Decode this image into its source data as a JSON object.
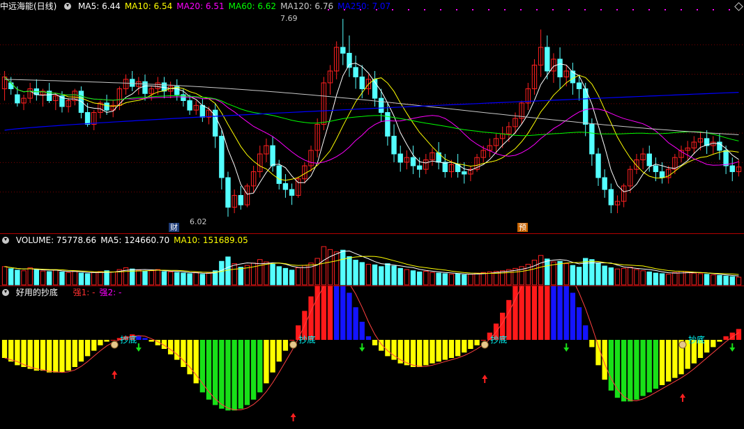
{
  "main": {
    "title": "中远海能(日线)",
    "ma_labels": [
      {
        "text": "MA5: 6.44",
        "color": "#ffffff"
      },
      {
        "text": "MA10: 6.54",
        "color": "#ffff00"
      },
      {
        "text": "MA20: 6.51",
        "color": "#ff00ff"
      },
      {
        "text": "MA60: 6.62",
        "color": "#00ff00"
      },
      {
        "text": "MA120: 6.76",
        "color": "#c8c8c8"
      },
      {
        "text": "MA250: 7.07",
        "color": "#0000ff"
      }
    ],
    "high_label": "7.69",
    "low_label": "6.02",
    "event_cai": "财",
    "event_yu": "预"
  },
  "volume": {
    "labels": [
      {
        "text": "VOLUME: 75778.66",
        "color": "#ffffff"
      },
      {
        "text": "MA5: 124660.70",
        "color": "#ffffff"
      },
      {
        "text": "MA10: 151689.05",
        "color": "#ffff00"
      }
    ]
  },
  "indicator": {
    "title": "好用的抄底",
    "labels": [
      {
        "text": "强1: -",
        "color": "#ff3030"
      },
      {
        "text": "强2: -",
        "color": "#ff00ff"
      }
    ],
    "signal_text": "抄底"
  },
  "colors": {
    "up": "#ff2020",
    "down": "#54ffff",
    "grid": "#800000",
    "ma5": "#ffffff",
    "ma10": "#ffff00",
    "ma20": "#ff00ff",
    "ma60": "#00ff00",
    "ma120": "#c8c8c8",
    "ma250": "#0000ff"
  },
  "chart_data": {
    "type": "candlestick",
    "price_high": 7.69,
    "price_low": 6.02,
    "ma_last": {
      "ma5": 6.44,
      "ma10": 6.54,
      "ma20": 6.51,
      "ma60": 6.62,
      "ma120": 6.76,
      "ma250": 7.07
    },
    "volume_last": 75778.66,
    "volume_ma5": 124660.7,
    "volume_ma10": 151689.05,
    "candles": [
      [
        7.1,
        7.25,
        7.2,
        7.0
      ],
      [
        7.15,
        7.2,
        7.1,
        7.05
      ],
      [
        7.05,
        7.12,
        6.98,
        6.95
      ],
      [
        6.98,
        7.05,
        7.02,
        6.92
      ],
      [
        7.02,
        7.15,
        7.1,
        6.98
      ],
      [
        7.1,
        7.18,
        7.05,
        7.0
      ],
      [
        7.05,
        7.1,
        7.08,
        6.95
      ],
      [
        7.08,
        7.15,
        7.0,
        6.98
      ],
      [
        7.0,
        7.06,
        7.04,
        6.92
      ],
      [
        7.04,
        7.08,
        6.95,
        6.9
      ],
      [
        6.95,
        7.02,
        7.0,
        6.9
      ],
      [
        7.0,
        7.1,
        7.08,
        6.96
      ],
      [
        7.08,
        7.12,
        6.9,
        6.85
      ],
      [
        6.9,
        6.98,
        6.8,
        6.78
      ],
      [
        6.8,
        6.92,
        6.9,
        6.75
      ],
      [
        6.9,
        7.0,
        6.98,
        6.85
      ],
      [
        6.98,
        7.05,
        6.92,
        6.88
      ],
      [
        6.92,
        7.0,
        6.96,
        6.86
      ],
      [
        6.96,
        7.12,
        7.1,
        6.92
      ],
      [
        7.1,
        7.22,
        7.18,
        7.05
      ],
      [
        7.18,
        7.25,
        7.12,
        7.08
      ],
      [
        7.12,
        7.2,
        7.16,
        7.05
      ],
      [
        7.16,
        7.22,
        7.06,
        7.0
      ],
      [
        7.06,
        7.12,
        7.1,
        7.0
      ],
      [
        7.1,
        7.2,
        7.15,
        7.05
      ],
      [
        7.15,
        7.2,
        7.08,
        7.02
      ],
      [
        7.08,
        7.16,
        7.12,
        7.02
      ],
      [
        7.12,
        7.18,
        7.05,
        7.0
      ],
      [
        7.05,
        7.1,
        7.0,
        6.95
      ],
      [
        7.0,
        7.05,
        6.92,
        6.88
      ],
      [
        6.92,
        7.0,
        6.96,
        6.88
      ],
      [
        6.96,
        7.02,
        6.86,
        6.82
      ],
      [
        6.86,
        6.95,
        6.92,
        6.8
      ],
      [
        6.92,
        6.98,
        6.7,
        6.6
      ],
      [
        6.7,
        6.75,
        6.35,
        6.25
      ],
      [
        6.35,
        6.4,
        6.1,
        6.02
      ],
      [
        6.1,
        6.25,
        6.2,
        6.05
      ],
      [
        6.2,
        6.28,
        6.12,
        6.08
      ],
      [
        6.12,
        6.3,
        6.28,
        6.1
      ],
      [
        6.28,
        6.45,
        6.4,
        6.22
      ],
      [
        6.4,
        6.62,
        6.55,
        6.35
      ],
      [
        6.55,
        6.68,
        6.62,
        6.48
      ],
      [
        6.62,
        6.7,
        6.45,
        6.4
      ],
      [
        6.45,
        6.5,
        6.3,
        6.25
      ],
      [
        6.3,
        6.38,
        6.25,
        6.18
      ],
      [
        6.25,
        6.3,
        6.2,
        6.12
      ],
      [
        6.2,
        6.36,
        6.34,
        6.18
      ],
      [
        6.34,
        6.48,
        6.45,
        6.3
      ],
      [
        6.45,
        6.62,
        6.58,
        6.4
      ],
      [
        6.58,
        6.85,
        6.8,
        6.52
      ],
      [
        6.8,
        7.2,
        7.15,
        6.75
      ],
      [
        7.15,
        7.3,
        7.25,
        7.05
      ],
      [
        7.25,
        7.5,
        7.45,
        7.18
      ],
      [
        7.45,
        7.69,
        7.4,
        7.3
      ],
      [
        7.4,
        7.55,
        7.28,
        7.2
      ],
      [
        7.28,
        7.38,
        7.2,
        7.1
      ],
      [
        7.2,
        7.3,
        7.1,
        7.02
      ],
      [
        7.1,
        7.22,
        7.18,
        7.05
      ],
      [
        7.18,
        7.25,
        7.02,
        6.95
      ],
      [
        7.02,
        7.1,
        6.9,
        6.82
      ],
      [
        6.9,
        6.98,
        6.7,
        6.62
      ],
      [
        6.7,
        6.8,
        6.55,
        6.48
      ],
      [
        6.55,
        6.62,
        6.48,
        6.4
      ],
      [
        6.48,
        6.58,
        6.52,
        6.42
      ],
      [
        6.52,
        6.62,
        6.45,
        6.38
      ],
      [
        6.45,
        6.52,
        6.42,
        6.35
      ],
      [
        6.42,
        6.55,
        6.5,
        6.38
      ],
      [
        6.5,
        6.6,
        6.56,
        6.45
      ],
      [
        6.56,
        6.65,
        6.48,
        6.42
      ],
      [
        6.48,
        6.55,
        6.4,
        6.35
      ],
      [
        6.4,
        6.5,
        6.46,
        6.35
      ],
      [
        6.46,
        6.55,
        6.4,
        6.35
      ],
      [
        6.4,
        6.48,
        6.38,
        6.3
      ],
      [
        6.38,
        6.45,
        6.42,
        6.32
      ],
      [
        6.42,
        6.55,
        6.52,
        6.4
      ],
      [
        6.52,
        6.62,
        6.58,
        6.48
      ],
      [
        6.58,
        6.68,
        6.62,
        6.52
      ],
      [
        6.62,
        6.72,
        6.68,
        6.55
      ],
      [
        6.68,
        6.78,
        6.72,
        6.6
      ],
      [
        6.72,
        6.82,
        6.78,
        6.65
      ],
      [
        6.78,
        6.9,
        6.85,
        6.72
      ],
      [
        6.85,
        7.0,
        6.98,
        6.8
      ],
      [
        6.98,
        7.15,
        7.1,
        6.92
      ],
      [
        7.1,
        7.35,
        7.3,
        7.05
      ],
      [
        7.3,
        7.6,
        7.45,
        7.2
      ],
      [
        7.45,
        7.55,
        7.25,
        7.18
      ],
      [
        7.25,
        7.4,
        7.35,
        7.15
      ],
      [
        7.35,
        7.45,
        7.2,
        7.1
      ],
      [
        7.2,
        7.3,
        7.25,
        7.12
      ],
      [
        7.25,
        7.32,
        7.15,
        7.05
      ],
      [
        7.15,
        7.22,
        7.1,
        7.0
      ],
      [
        7.1,
        7.15,
        6.8,
        6.7
      ],
      [
        6.8,
        6.85,
        6.55,
        6.45
      ],
      [
        6.55,
        6.6,
        6.35,
        6.28
      ],
      [
        6.35,
        6.42,
        6.25,
        6.18
      ],
      [
        6.25,
        6.3,
        6.12,
        6.05
      ],
      [
        6.12,
        6.2,
        6.15,
        6.05
      ],
      [
        6.15,
        6.3,
        6.28,
        6.1
      ],
      [
        6.28,
        6.45,
        6.42,
        6.22
      ],
      [
        6.42,
        6.55,
        6.5,
        6.38
      ],
      [
        6.5,
        6.6,
        6.55,
        6.42
      ],
      [
        6.55,
        6.62,
        6.45,
        6.4
      ],
      [
        6.45,
        6.52,
        6.4,
        6.32
      ],
      [
        6.4,
        6.48,
        6.35,
        6.3
      ],
      [
        6.35,
        6.45,
        6.42,
        6.3
      ],
      [
        6.42,
        6.55,
        6.52,
        6.38
      ],
      [
        6.52,
        6.62,
        6.58,
        6.48
      ],
      [
        6.58,
        6.66,
        6.6,
        6.5
      ],
      [
        6.6,
        6.7,
        6.65,
        6.55
      ],
      [
        6.65,
        6.74,
        6.68,
        6.58
      ],
      [
        6.68,
        6.75,
        6.62,
        6.55
      ],
      [
        6.62,
        6.7,
        6.65,
        6.55
      ],
      [
        6.65,
        6.72,
        6.58,
        6.5
      ],
      [
        6.58,
        6.62,
        6.45,
        6.38
      ],
      [
        6.45,
        6.52,
        6.4,
        6.32
      ],
      [
        6.4,
        6.5,
        6.44,
        6.36
      ]
    ],
    "volume": [
      62,
      55,
      50,
      48,
      58,
      52,
      47,
      45,
      50,
      44,
      42,
      46,
      40,
      38,
      42,
      45,
      48,
      44,
      52,
      58,
      54,
      50,
      46,
      48,
      52,
      45,
      44,
      42,
      40,
      38,
      42,
      36,
      40,
      48,
      80,
      95,
      72,
      60,
      66,
      74,
      86,
      78,
      70,
      62,
      56,
      50,
      58,
      66,
      74,
      90,
      130,
      120,
      112,
      118,
      96,
      84,
      76,
      70,
      68,
      62,
      72,
      64,
      56,
      52,
      48,
      44,
      46,
      42,
      40,
      38,
      36,
      38,
      34,
      36,
      40,
      42,
      44,
      46,
      48,
      52,
      56,
      62,
      70,
      84,
      100,
      88,
      78,
      80,
      72,
      66,
      60,
      90,
      86,
      74,
      64,
      58,
      54,
      56,
      60,
      52,
      48,
      44,
      40,
      38,
      36,
      42,
      46,
      44,
      40,
      38,
      36,
      34,
      32,
      30,
      28,
      26
    ],
    "indicator": [
      -10,
      -12,
      -14,
      -15,
      -16,
      -17,
      -17,
      -18,
      -18,
      -18,
      -17,
      -15,
      -12,
      -9,
      -6,
      -3,
      -1,
      0,
      1,
      2,
      3,
      2,
      1,
      -1,
      -3,
      -5,
      -8,
      -11,
      -15,
      -19,
      -24,
      -29,
      -33,
      -36,
      -38,
      -39,
      -39,
      -38,
      -36,
      -33,
      -29,
      -24,
      -18,
      -12,
      -6,
      0,
      8,
      16,
      24,
      30,
      34,
      36,
      35,
      32,
      26,
      18,
      10,
      2,
      -3,
      -6,
      -9,
      -11,
      -13,
      -14,
      -15,
      -15,
      -14,
      -13,
      -12,
      -11,
      -10,
      -9,
      -7,
      -5,
      -3,
      0,
      4,
      9,
      15,
      22,
      30,
      36,
      40,
      43,
      44,
      44,
      43,
      40,
      34,
      26,
      18,
      8,
      -4,
      -14,
      -22,
      -28,
      -32,
      -34,
      -34,
      -33,
      -31,
      -29,
      -27,
      -25,
      -23,
      -21,
      -19,
      -16,
      -13,
      -10,
      -7,
      -4,
      -1,
      2,
      4,
      6
    ]
  }
}
